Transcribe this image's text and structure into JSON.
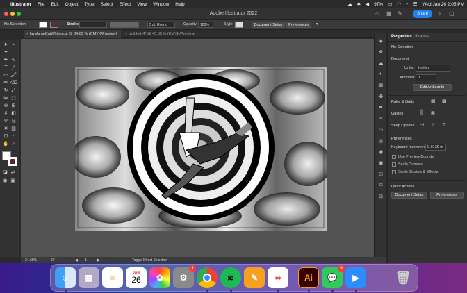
{
  "menubar": {
    "app": "Illustrator",
    "items": [
      "File",
      "Edit",
      "Object",
      "Type",
      "Select",
      "Effect",
      "View",
      "Window",
      "Help"
    ],
    "battery": "97%",
    "clock": "Wed Jan 26  2:05 PM"
  },
  "titlebar": {
    "title": "Adobe Illustrator 2022",
    "share_label": "Share"
  },
  "control": {
    "selection": "No Selection",
    "stroke_label": "Stroke:",
    "brush": "5 pt. Round",
    "opacity_label": "Opacity:",
    "opacity": "100%",
    "style_label": "Style:",
    "doc_setup": "Document Setup",
    "preferences": "Preferences"
  },
  "tabs": [
    {
      "label": "lavalampCatWhiting.ai @ 34.69 % (CMYK/Preview)"
    },
    {
      "label": "Untitled-4* @ 45.05 % (CMYK/Preview)"
    }
  ],
  "status": {
    "zoom": "34.69%",
    "rotation": "0°",
    "artboard": "1",
    "tool": "Toggle Direct Selection"
  },
  "panel": {
    "tabs": [
      "Properties",
      "Libraries"
    ],
    "selection": "No Selection",
    "document": "Document",
    "units_label": "Units:",
    "units": "Inches",
    "artboard_label": "Artboard:",
    "artboard_value": "1",
    "edit_artboards": "Edit Artboards",
    "ruler_grids": "Ruler & Grids",
    "guides": "Guides",
    "snap": "Snap Options",
    "prefs_head": "Preferences",
    "keyboard_label": "Keyboard Increment:",
    "keyboard_value": "0.0139 in",
    "use_preview": "Use Preview Bounds",
    "scale_corners": "Scale Corners",
    "scale_strokes": "Scale Strokes & Effects",
    "quick_actions": "Quick Actions",
    "doc_setup": "Document Setup",
    "preferences": "Preferences"
  },
  "dock": {
    "calendar_month": "JAN",
    "calendar_day": "26",
    "settings_badge": "1",
    "messages_badge": "9",
    "ai_label": "Ai"
  }
}
